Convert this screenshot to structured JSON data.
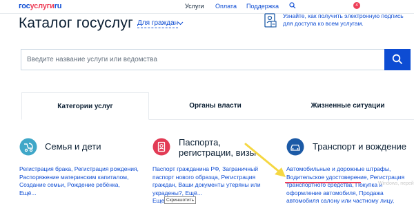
{
  "header": {
    "logo_part1": "гос",
    "logo_part2": "услуги",
    "logo_part3": "ru",
    "nav": [
      "Услуги",
      "Оплата",
      "Поддержка"
    ],
    "notification_count": "4"
  },
  "catalog": {
    "title": "Каталог госуслуг",
    "audience": "Для граждан"
  },
  "promo": {
    "text": "Узнайте, как получить электронную подпись для доступа ко всем услугам."
  },
  "search": {
    "placeholder": "Введите название услуги или ведомства"
  },
  "tabs": [
    "Категории услуг",
    "Органы власти",
    "Жизненные ситуации"
  ],
  "categories": [
    {
      "title": "Семья и дети",
      "links_1": "Регистрация брака, Регистрация рождения,",
      "links_2": "Распоряжение материнским капиталом,",
      "links_3": "Создание семьи, Рождение ребёнка,",
      "links_4": "Ещё..."
    },
    {
      "title_1": "Паспорта,",
      "title_2": "регистрации, визы",
      "links_1": "Паспорт гражданина РФ, Заграничный",
      "links_2": "паспорт нового образца, Регистрация",
      "links_3": "граждан, Ваши документы утеряны или",
      "links_4": "украдены?, Ещё...",
      "links_5": "Еще..."
    },
    {
      "title": "Транспорт и вождение",
      "links_1": "Автомобильные и дорожные штрафы,",
      "links_2": "Водительское удостоверение",
      "links_2b": ", Регистрация",
      "links_3": "транспортного средства, Покупка и",
      "links_4": "оформление автомобиля, Продажа",
      "links_5": "автомобиля салону или частному лицу,"
    }
  ],
  "overlay": {
    "tooltip": "Скриншотить",
    "watermark": "Windows, перей"
  },
  "colors": {
    "brand_blue": "#0d4cd3",
    "brand_red": "#ee3f58",
    "icon_teal": "#3fa7c8",
    "icon_red": "#e23b55",
    "icon_blue": "#1c5aa6",
    "arrow_yellow": "#f5d742"
  }
}
